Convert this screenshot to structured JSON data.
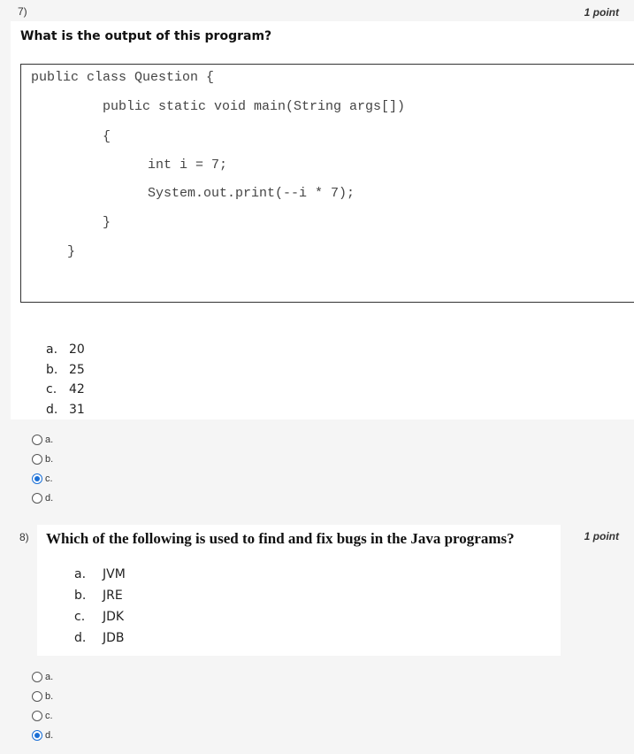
{
  "q7": {
    "number": "7)",
    "points": "1 point",
    "title": "What is the output of this program?",
    "code": [
      "public class Question {",
      "public static void main(String args[])",
      "{",
      "int i = 7;",
      "System.out.print(--i * 7);",
      "}",
      "}"
    ],
    "options": [
      {
        "letter": "a.",
        "text": "20"
      },
      {
        "letter": "b.",
        "text": "25"
      },
      {
        "letter": "c.",
        "text": "42"
      },
      {
        "letter": "d.",
        "text": "31"
      }
    ],
    "radios": [
      {
        "label": "a.",
        "checked": false
      },
      {
        "label": "b.",
        "checked": false
      },
      {
        "label": "c.",
        "checked": true
      },
      {
        "label": "d.",
        "checked": false
      }
    ]
  },
  "q8": {
    "number": "8)",
    "points": "1 point",
    "title": "Which of the following is used to find and fix bugs in the Java programs?",
    "options": [
      {
        "letter": "a.",
        "text": "JVM"
      },
      {
        "letter": "b.",
        "text": "JRE"
      },
      {
        "letter": "c.",
        "text": "JDK"
      },
      {
        "letter": "d.",
        "text": "JDB"
      }
    ],
    "radios": [
      {
        "label": "a.",
        "checked": false
      },
      {
        "label": "b.",
        "checked": false
      },
      {
        "label": "c.",
        "checked": false
      },
      {
        "label": "d.",
        "checked": true
      }
    ]
  },
  "colors": {
    "accent": "#1a6fd6"
  }
}
